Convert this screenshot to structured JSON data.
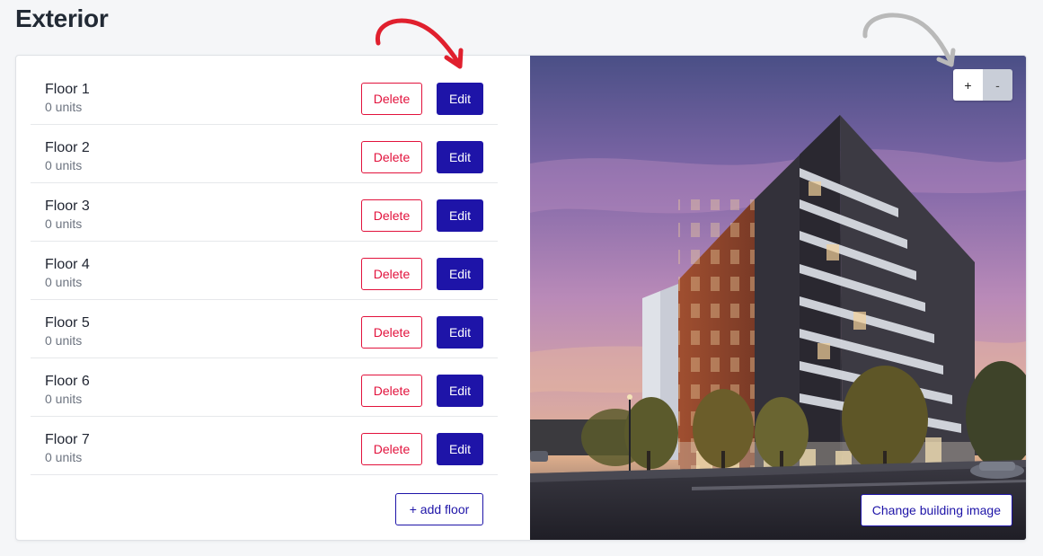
{
  "page": {
    "title": "Exterior"
  },
  "floors": [
    {
      "name": "Floor 1",
      "units": "0 units"
    },
    {
      "name": "Floor 2",
      "units": "0 units"
    },
    {
      "name": "Floor 3",
      "units": "0 units"
    },
    {
      "name": "Floor 4",
      "units": "0 units"
    },
    {
      "name": "Floor 5",
      "units": "0 units"
    },
    {
      "name": "Floor 6",
      "units": "0 units"
    },
    {
      "name": "Floor 7",
      "units": "0 units"
    }
  ],
  "actions": {
    "delete_label": "Delete",
    "edit_label": "Edit",
    "add_floor_label": "+ add floor"
  },
  "image_panel": {
    "zoom_in_label": "+",
    "zoom_out_label": "-",
    "change_image_label": "Change building image"
  },
  "annotations": {
    "edit_arrow_color": "#e0202e",
    "zoom_arrow_color": "#b9b9b9"
  },
  "colors": {
    "primary": "#1e14a8",
    "danger": "#e2123c",
    "background": "#f5f6f8"
  }
}
